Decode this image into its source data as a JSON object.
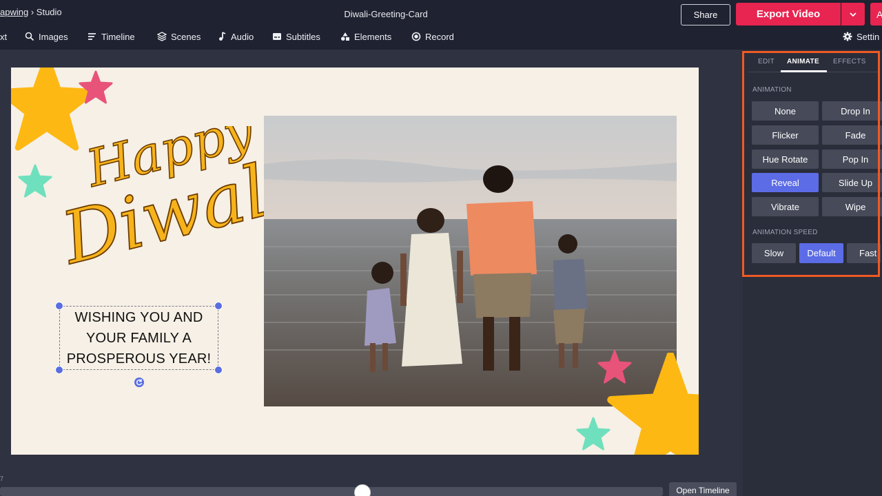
{
  "header": {
    "breadcrumb_app": "apwing",
    "breadcrumb_sep": "›",
    "breadcrumb_page": "Studio",
    "project_title": "Diwali-Greeting-Card",
    "share_label": "Share",
    "export_label": "Export Video",
    "avatar_initial": "A"
  },
  "toolbar": {
    "text": "xt",
    "images": "Images",
    "timeline": "Timeline",
    "scenes": "Scenes",
    "audio": "Audio",
    "subtitles": "Subtitles",
    "elements": "Elements",
    "record": "Record",
    "settings": "Settin"
  },
  "canvas": {
    "title_line1": "Happy",
    "title_line2": "Diwali",
    "text_box_lines": [
      "WISHING YOU AND",
      "YOUR FAMILY A",
      "PROSPEROUS YEAR!"
    ],
    "colors": {
      "background": "#f6f0e6",
      "script_fill": "#f6b31b",
      "star_orange": "#fdb813",
      "star_pink": "#e8537a",
      "star_mint": "#6fe0bd"
    }
  },
  "panel": {
    "tabs": [
      "EDIT",
      "ANIMATE",
      "EFFECTS"
    ],
    "active_tab": "ANIMATE",
    "animation_label": "ANIMATION",
    "animations": [
      "None",
      "Drop In",
      "Flicker",
      "Fade",
      "Hue Rotate",
      "Pop In",
      "Reveal",
      "Slide Up",
      "Vibrate",
      "Wipe"
    ],
    "selected_animation": "Reveal",
    "speed_label": "ANIMATION SPEED",
    "speeds": [
      "Slow",
      "Default",
      "Fast"
    ],
    "selected_speed": "Default",
    "highlight_color": "#f05a24",
    "selected_color": "#5c6ce6"
  },
  "timeline": {
    "time_marker": "7",
    "open_timeline_label": "Open Timeline",
    "playhead_fraction": 0.54
  }
}
